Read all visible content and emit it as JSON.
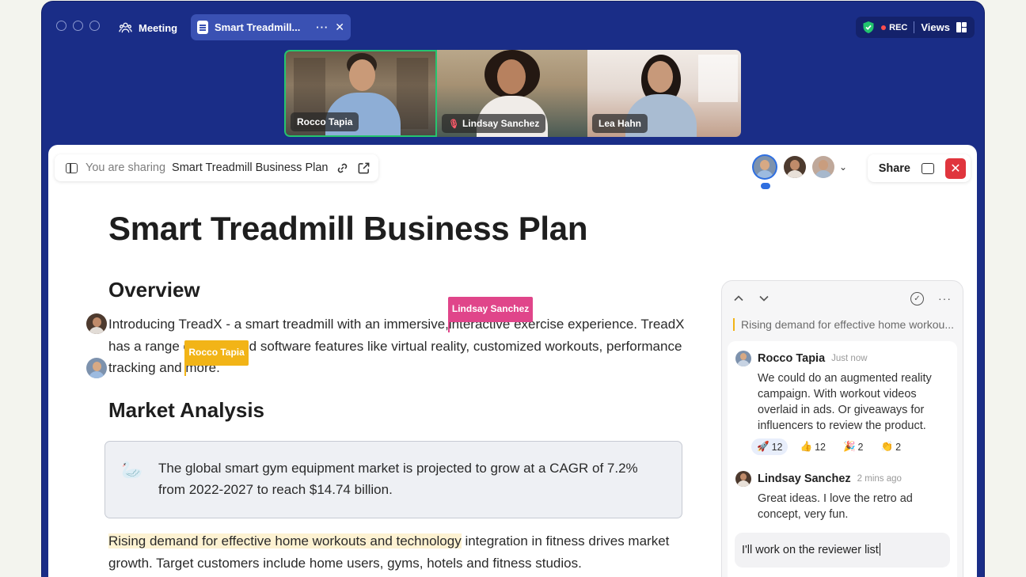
{
  "window": {
    "meeting_tab": "Meeting",
    "doc_tab": "Smart Treadmill...",
    "doc_tab_more": "···",
    "doc_tab_close": "✕",
    "rec_label": "REC",
    "views_label": "Views"
  },
  "participants": [
    {
      "name": "Rocco Tapia",
      "active_speaker": true,
      "muted": false
    },
    {
      "name": "Lindsay Sanchez",
      "active_speaker": false,
      "muted": true
    },
    {
      "name": "Lea Hahn",
      "active_speaker": false,
      "muted": false
    }
  ],
  "share_bar": {
    "prefix": "You are sharing",
    "doc_name": "Smart Treadmill Business Plan"
  },
  "actions": {
    "share_label": "Share",
    "close_label": "✕"
  },
  "document": {
    "title": "Smart Treadmill Business Plan",
    "overview_heading": "Overview",
    "overview_part1": "Introducing TreadX - a smart treadmill with an immersive,",
    "overview_part2": "interactive exercise experience. TreadX has a range of advanced software features like virtual reality, customized workouts, performance tracking and",
    "overview_part3": "more.",
    "market_heading": "Market Analysis",
    "callout_text": "The global smart gym equipment market is projected to grow at a CAGR of 7.2% from 2022-2027 to reach $14.74 billion.",
    "highlight_text": "Rising demand for effective home workouts and technology",
    "para2_rest": " integration in fitness drives market growth. Target customers include home users, gyms, hotels and fitness studios."
  },
  "cursors": {
    "lindsay": "Lindsay Sanchez",
    "rocco": "Rocco Tapia"
  },
  "comments": {
    "quote": "Rising demand for effective home workou...",
    "items": [
      {
        "author": "Rocco Tapia",
        "time": "Just now",
        "body": "We could do an augmented reality campaign. With workout videos overlaid in ads. Or giveaways for influencers to review the product.",
        "reactions": [
          {
            "emoji": "🚀",
            "count": "12"
          },
          {
            "emoji": "👍",
            "count": "12"
          },
          {
            "emoji": "🎉",
            "count": "2"
          },
          {
            "emoji": "👏",
            "count": "2"
          }
        ]
      },
      {
        "author": "Lindsay Sanchez",
        "time": "2 mins ago",
        "body": "Great ideas. I love the retro ad concept, very fun."
      }
    ],
    "reply_text": "I'll work on the reviewer list"
  },
  "colors": {
    "window_bg": "#1a2d87",
    "active_speaker": "#25c46f",
    "lindsay_cursor": "#e0458a",
    "rocco_cursor": "#f2b417",
    "close_red": "#e0353d"
  },
  "icons": [
    "people-icon",
    "doc-icon",
    "shield-icon",
    "views-icon",
    "sidebar-icon",
    "link-icon",
    "external-link-icon",
    "comment-icon",
    "chevron-up-icon",
    "chevron-down-icon",
    "resolve-icon",
    "swan-icon"
  ]
}
